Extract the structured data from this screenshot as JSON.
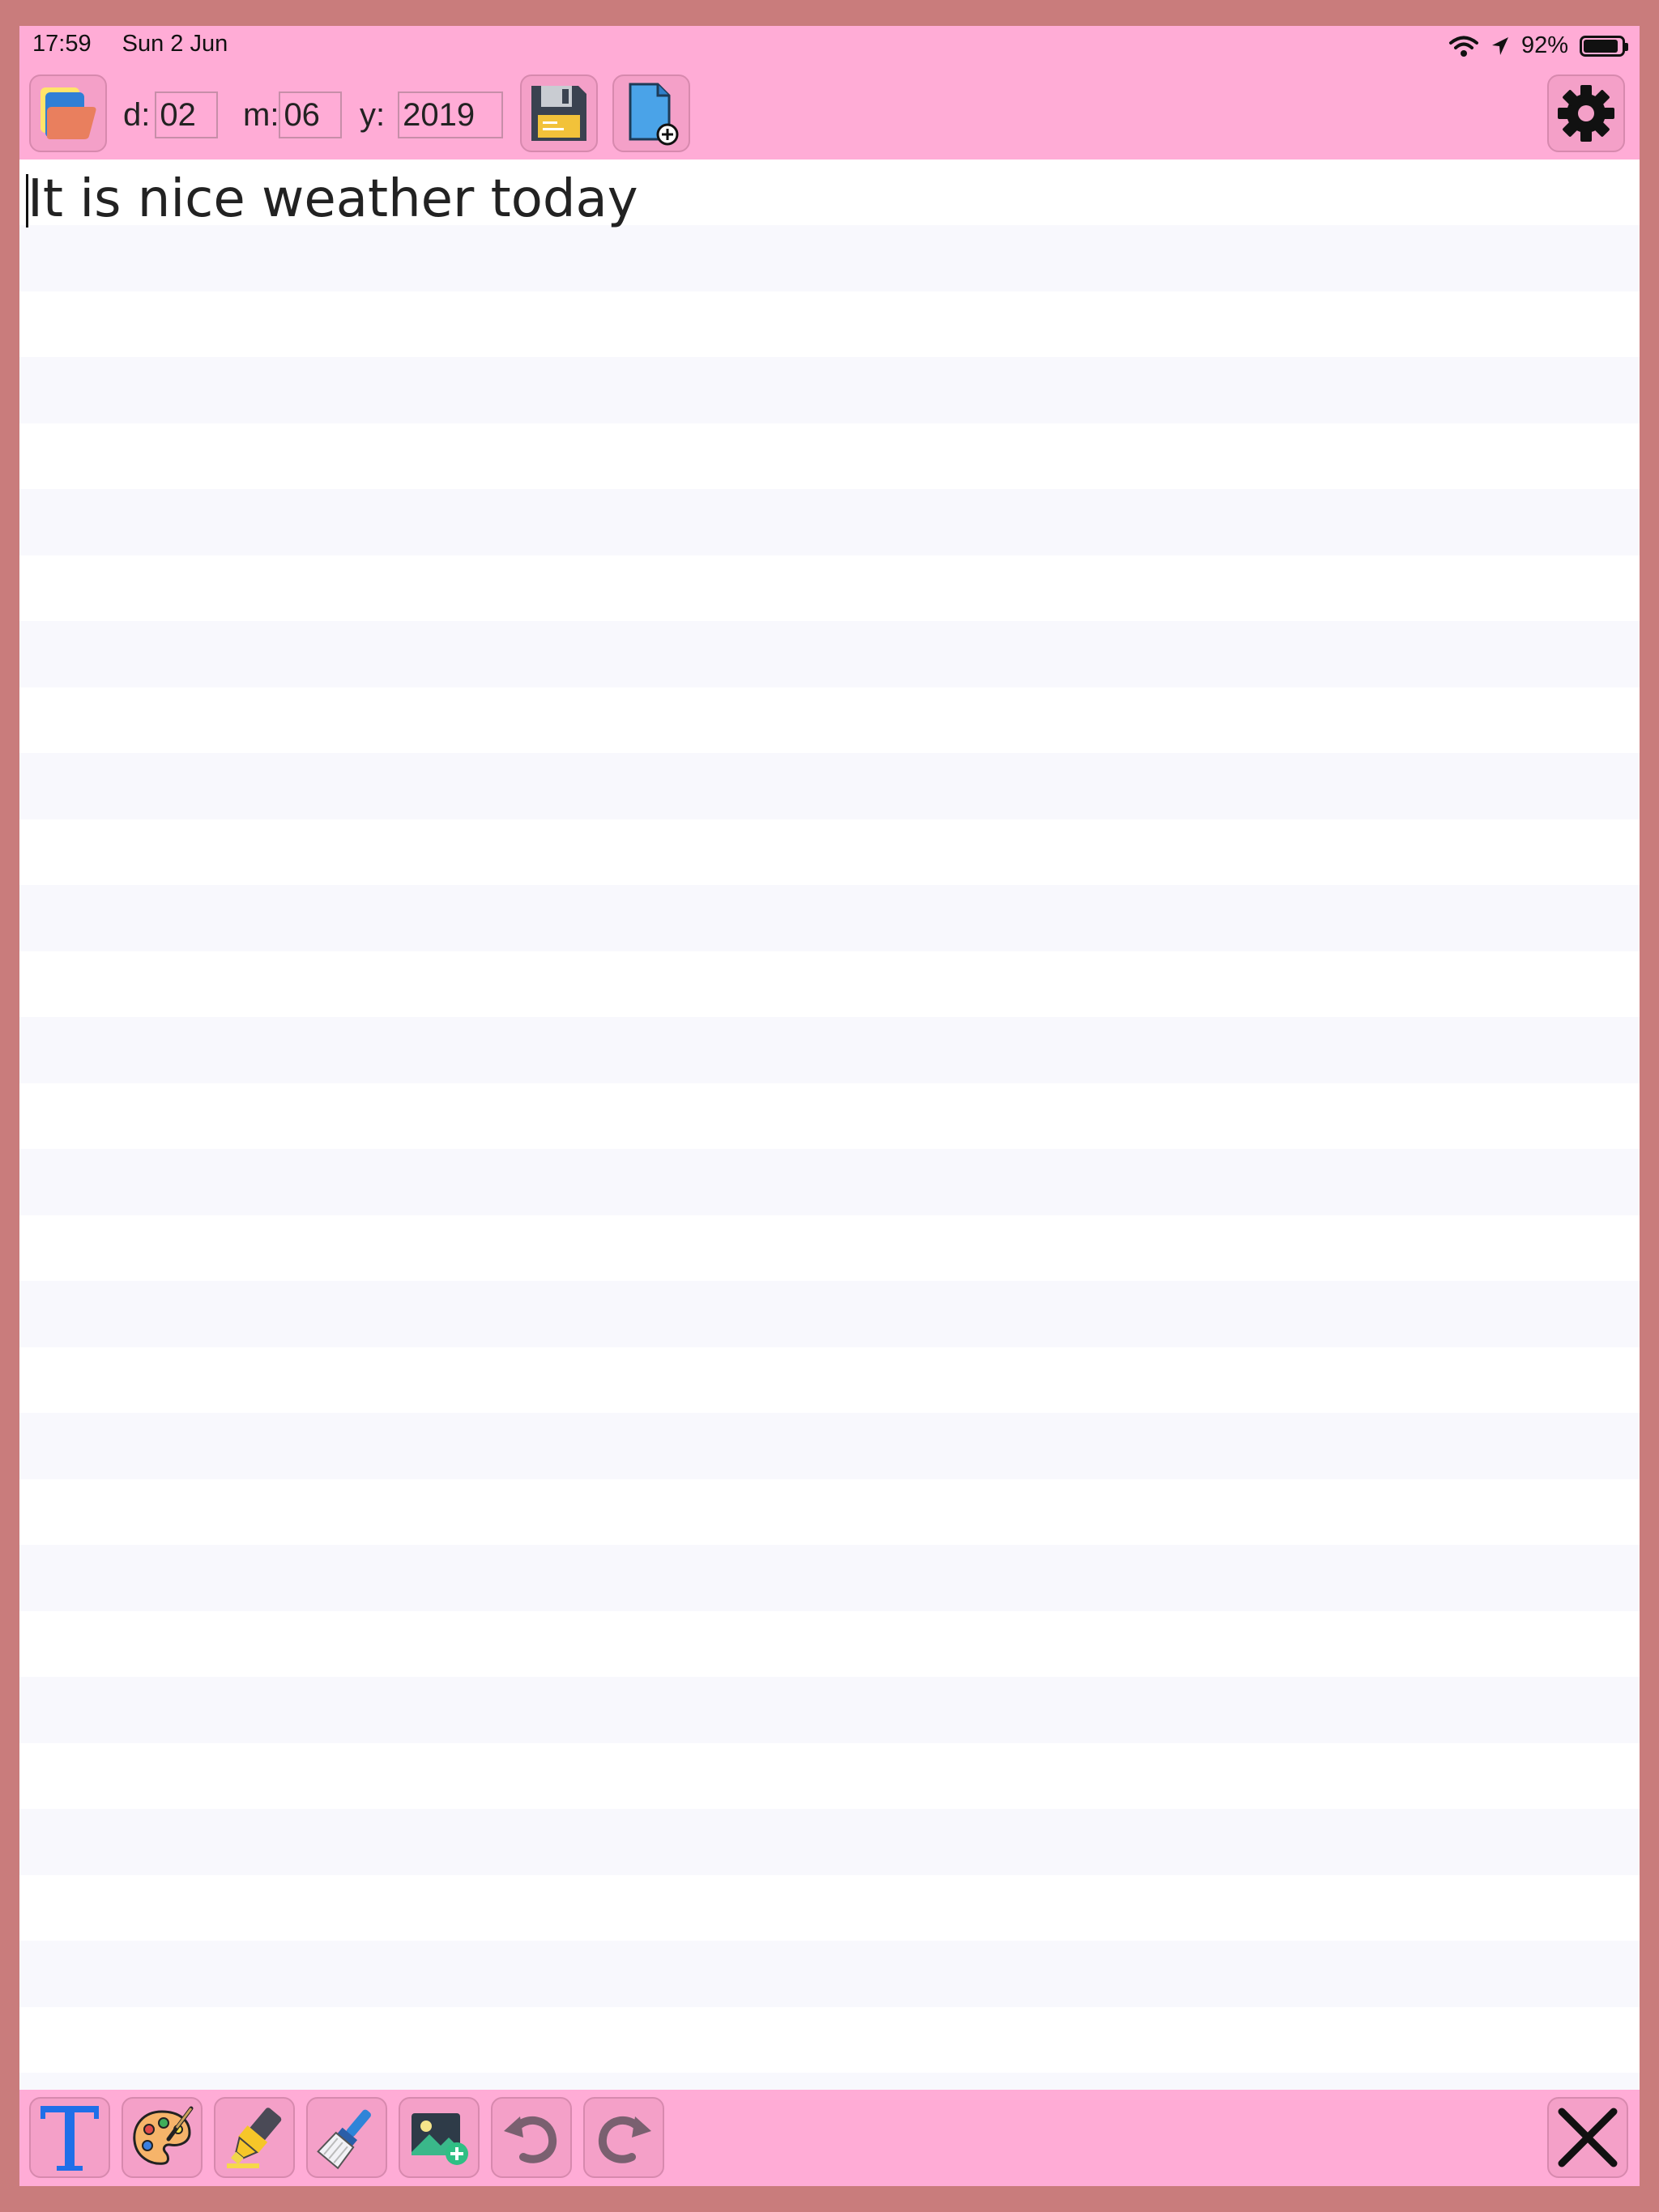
{
  "status_bar": {
    "time": "17:59",
    "date": "Sun 2 Jun",
    "battery": "92%",
    "battery_level": 0.92
  },
  "toolbar": {
    "day_label": "d:",
    "day_value": "02",
    "month_label": "m:",
    "month_value": "06",
    "year_label": "y:",
    "year_value": "2019",
    "icons": [
      "folder-icon",
      "floppy-disk-icon",
      "new-document-icon",
      "gear-icon"
    ]
  },
  "editor": {
    "text": "It is nice weather today"
  },
  "bottom_toolbar": {
    "icons": [
      "text-format-icon",
      "palette-icon",
      "highlighter-icon",
      "paint-brush-icon",
      "add-image-icon",
      "undo-icon",
      "redo-icon",
      "close-icon"
    ]
  },
  "colors": {
    "frame": "#c97c7c",
    "bars": "#ffacd6",
    "button": "#f4a0c8",
    "text_tool": "#1f6fe8"
  }
}
